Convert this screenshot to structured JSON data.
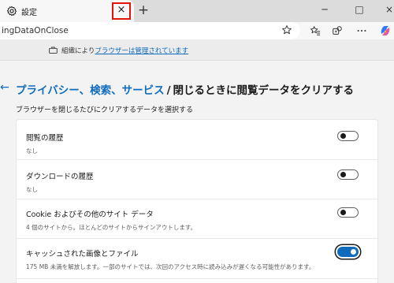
{
  "tab": {
    "title": "設定",
    "close_glyph": "×",
    "new_tab_glyph": "+"
  },
  "window_controls": {
    "minimize": "─",
    "maximize": "□",
    "close": "×"
  },
  "address_bar": {
    "text": "ingDataOnClose"
  },
  "managed_banner": {
    "prefix": "組織により",
    "link_text": "ブラウザーは管理されています"
  },
  "page": {
    "breadcrumb_parent": "プライバシー、検索、サービス",
    "breadcrumb_separator": "/",
    "title": "閉じるときに閲覧データをクリアする",
    "subtitle": "ブラウザーを閉じるたびにクリアするデータを選択する"
  },
  "settings": [
    {
      "title": "閲覧の履歴",
      "description": "なし",
      "enabled": false
    },
    {
      "title": "ダウンロードの履歴",
      "description": "なし",
      "enabled": false
    },
    {
      "title": "Cookie およびその他のサイト データ",
      "description": "4 個のサイトから。ほとんどのサイトからサインアウトします。",
      "enabled": false
    },
    {
      "title": "キャッシュされた画像とファイル",
      "description": "175 MB 未満を解放します。一部のサイトでは、次回のアクセス時に読み込みが遅くなる可能性があります。",
      "enabled": true
    }
  ],
  "colors": {
    "accent": "#0f6cbd",
    "highlight": "#e3120b"
  }
}
